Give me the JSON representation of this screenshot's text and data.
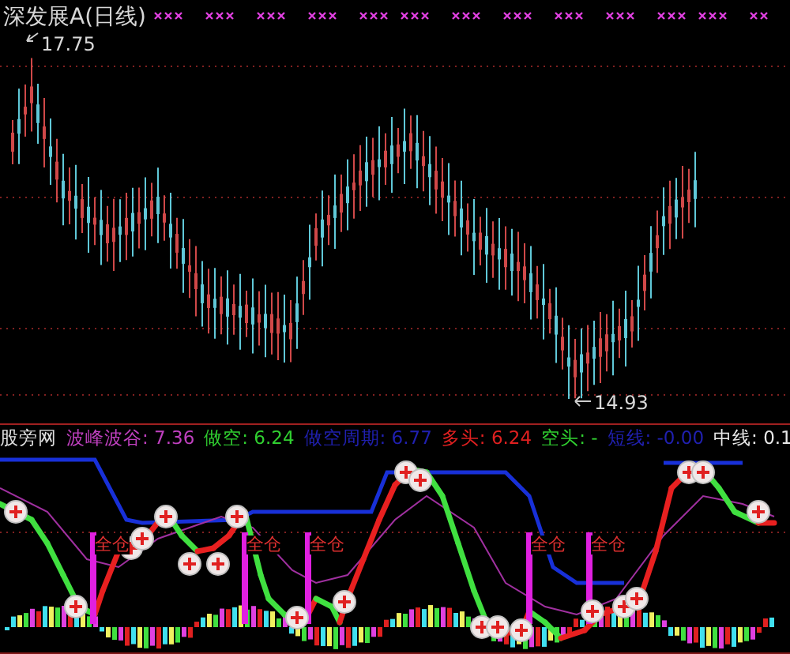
{
  "title": "深发展A(日线)",
  "price_panel": {
    "high_label": "17.75",
    "low_label": "14.93"
  },
  "indicator_panel": {
    "name": "股旁网",
    "legend": [
      {
        "label": "波峰波谷:",
        "value": "7.36",
        "color": "#c040c0"
      },
      {
        "label": "做空:",
        "value": "6.24",
        "color": "#30d030"
      },
      {
        "label": "做空周期:",
        "value": "6.77",
        "color": "#2020b0"
      },
      {
        "label": "多头:",
        "value": "6.24",
        "color": "#e02020"
      },
      {
        "label": "空头:",
        "value": "-",
        "color": "#30d030"
      },
      {
        "label": "短线:",
        "value": "-0.00",
        "color": "#2020b0"
      },
      {
        "label": "中线:",
        "value": "0.1",
        "color": "#e8e8e8"
      }
    ],
    "signal_labels": [
      "全仓",
      "全仓",
      "全仓",
      "全仓",
      "全仓"
    ]
  }
}
